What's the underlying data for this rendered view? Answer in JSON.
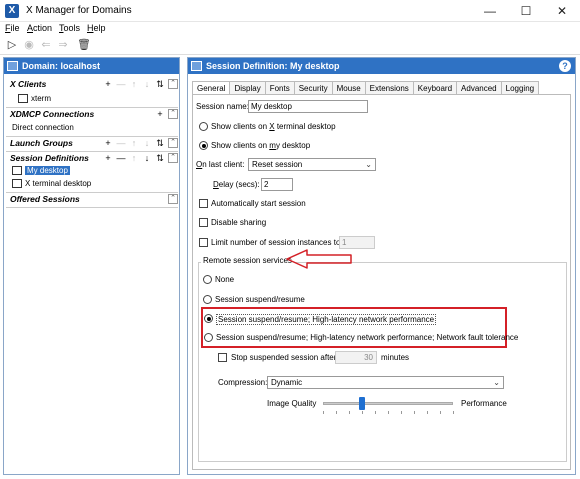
{
  "window": {
    "title": "X Manager for Domains",
    "minimize": "—",
    "maximize": "☐",
    "close": "✕"
  },
  "menu": {
    "file": "ile",
    "file_u": "F",
    "action_u": "A",
    "action": "ction",
    "tools_u": "T",
    "tools": "ools",
    "help_u": "H",
    "help": "elp"
  },
  "left": {
    "header": "Domain:  localhost",
    "sections": {
      "xclients": "X Clients",
      "xdmcp": "XDMCP Connections",
      "launch": "Launch Groups",
      "sessiondefs": "Session Definitions",
      "offered": "Offered Sessions"
    },
    "items": {
      "xterm": "xterm",
      "direct": "Direct connection",
      "mydesktop": "My desktop",
      "xterminal": "X terminal desktop"
    }
  },
  "right": {
    "header": "Session Definition:  My desktop",
    "tabs": [
      "General",
      "Display",
      "Fonts",
      "Security",
      "Mouse",
      "Extensions",
      "Keyboard",
      "Advanced",
      "Logging"
    ],
    "session_name_label": "Session name:",
    "session_name_value": "My desktop",
    "show_x_pre": "Show clients on ",
    "show_x_u": "X",
    "show_x_post": " terminal desktop",
    "show_my_pre": "Show clients on ",
    "show_my_u": "m",
    "show_my_post": "y desktop",
    "on_last_u": "O",
    "on_last": "n last client:",
    "on_last_value": "Reset session",
    "delay_u": "D",
    "delay": "elay (secs):",
    "delay_value": "2",
    "auto_start": "Automatically start session",
    "disable_sharing": "Disable sharing",
    "limit_instances": "Limit number of session instances to",
    "limit_value": "1",
    "remote_group": "Remote session services",
    "opt_none": "None",
    "opt_suspend": "Session suspend/resume",
    "opt_highlat": "Session suspend/resume; High-latency network performance",
    "opt_fault": "Session suspend/resume; High-latency network performance; Network fault tolerance",
    "stop_after": "Stop suspended session after",
    "stop_value": "30",
    "minutes": "minutes",
    "compression_label": "Compression:",
    "compression_value": "Dynamic",
    "image_quality": "Image Quality",
    "performance": "Performance",
    "slider_level": 0.3
  },
  "colors": {
    "accent": "#2f72c4",
    "annotation_red": "#d42027"
  }
}
